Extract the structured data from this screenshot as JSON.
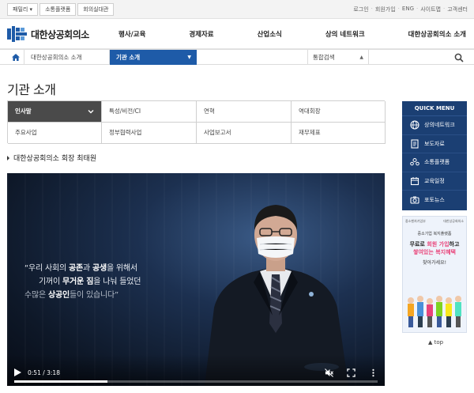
{
  "utility": {
    "left_buttons": [
      "패밀리 ▾",
      "소통플랫폼",
      "회의실대관"
    ],
    "right_links": [
      "로그인",
      "회원가입",
      "ENG",
      "사이트맵",
      "고객센터"
    ]
  },
  "header": {
    "logo_text": "대한상공회의소",
    "nav": [
      "행사/교육",
      "경제자료",
      "산업소식",
      "상의 네트워크",
      "대한상공회의소 소개"
    ]
  },
  "breadcrumb": {
    "parent": "대한상공회의소 소개",
    "current": "기관 소개",
    "search_label": "통합검색"
  },
  "page": {
    "title": "기관 소개",
    "section_heading": "대한상공회의소 회장 최태원"
  },
  "tabs": [
    {
      "label": "인사말",
      "active": true
    },
    {
      "label": "특성/비전/CI",
      "active": false
    },
    {
      "label": "연혁",
      "active": false
    },
    {
      "label": "역대회장",
      "active": false
    },
    {
      "label": "주요사업",
      "active": false
    },
    {
      "label": "정부협력사업",
      "active": false
    },
    {
      "label": "사업보고서",
      "active": false
    },
    {
      "label": "재무제표",
      "active": false
    }
  ],
  "video": {
    "quote_line1_pre": "“우리 사회의 ",
    "quote_line1_b1": "공존",
    "quote_line1_mid": "과 ",
    "quote_line1_b2": "공생",
    "quote_line1_post": "을 위해서",
    "quote_line2_pre": "기꺼이 ",
    "quote_line2_b1": "무거운 짐",
    "quote_line2_post": "을 나눠 들었던",
    "quote_line3_pre": "수많은 ",
    "quote_line3_b1": "상공인",
    "quote_line3_post": "들이 있습니다”",
    "time": "0:51 / 3:18",
    "progress": 0.257
  },
  "quick_menu": {
    "title": "QUICK MENU",
    "items": [
      "상의네트워크",
      "보도자료",
      "소통플랫폼",
      "교육일정",
      "포토뉴스"
    ]
  },
  "banner": {
    "org_left": "중소벤처기업부",
    "org_right": "대한상공회의소",
    "sub": "중소기업 복지플랫폼",
    "main_pre": "무료로 ",
    "main_accent": "회원 가입",
    "main_post": "하고",
    "main2": "쌓여있는 복지혜택",
    "cta": "찾아가세요!"
  },
  "top_link": "▲ top",
  "colors": {
    "brand_blue": "#1e5ba8",
    "quick_menu_bg": "#1b3f73",
    "active_tab_bg": "#4a4a4a",
    "accent_pink": "#e9447a"
  }
}
